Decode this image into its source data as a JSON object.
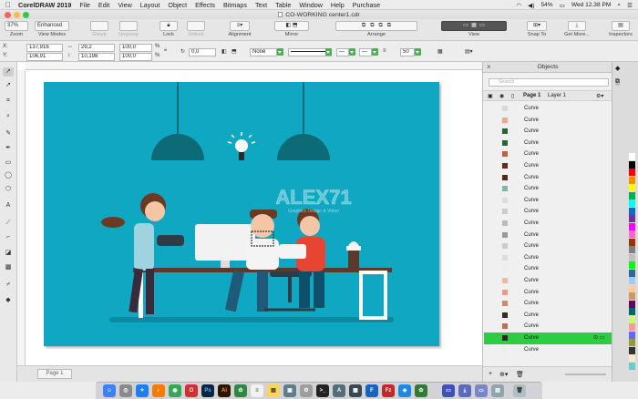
{
  "menubar": {
    "app_name": "CorelDRAW 2019",
    "items": [
      "File",
      "Edit",
      "View",
      "Layout",
      "Object",
      "Effects",
      "Bitmaps",
      "Text",
      "Table",
      "Window",
      "Help",
      "Purchase"
    ],
    "battery": "54%",
    "clock": "Wed 12.38 PM"
  },
  "window": {
    "title": "CO-WORKING center1.cdr"
  },
  "toolbar": {
    "zoom_value": "37%",
    "zoom_label": "Zoom",
    "view_mode_value": "Enhanced",
    "view_mode_label": "View Modes",
    "group_label": "Group",
    "ungroup_label": "Ungroup",
    "lock_label": "Lock",
    "unlock_label": "Unlock",
    "alignment_label": "Alignment",
    "mirror_label": "Mirror",
    "arrange_label": "Arrange",
    "view_label": "View",
    "snap_label": "Snap To",
    "getmore_label": "Get More...",
    "inspectors_label": "Inspectors"
  },
  "propbar": {
    "x": "137,916",
    "y": "106,91",
    "w": "29,2",
    "h": "10,198",
    "sx": "100,0",
    "sy": "100,0",
    "pct": "%",
    "angle": "0,0",
    "fill": "None",
    "outline_width": "50"
  },
  "canvas": {
    "watermark": "ALEX71",
    "watermark_sub": "Graphics Design & Video"
  },
  "pagebar": {
    "tab": "Page 1"
  },
  "objects": {
    "title": "Objects",
    "search_placeholder": "Search",
    "page": "Page 1",
    "layer": "Layer 1",
    "rows": [
      {
        "name": "Curve",
        "swatch": "#d9d9d9"
      },
      {
        "name": "Curve",
        "swatch": "#f0a58a"
      },
      {
        "name": "Curve",
        "swatch": "#1f6b2e"
      },
      {
        "name": "Curve",
        "swatch": "#1f6b2e"
      },
      {
        "name": "Curve",
        "swatch": "#c06040"
      },
      {
        "name": "Curve",
        "swatch": "#6a2c1a"
      },
      {
        "name": "Curve",
        "swatch": "#5a2818"
      },
      {
        "name": "Curve",
        "swatch": "#7fb8a8"
      },
      {
        "name": "Curve",
        "swatch": "#dddddd"
      },
      {
        "name": "Curve",
        "swatch": "#cccccc"
      },
      {
        "name": "Curve",
        "swatch": "#bbbbbb"
      },
      {
        "name": "Curve",
        "swatch": "#999999"
      },
      {
        "name": "Curve",
        "swatch": "#cccccc"
      },
      {
        "name": "Curve",
        "swatch": "#dddddd"
      },
      {
        "name": "Curve",
        "swatch": "#eeeeee"
      },
      {
        "name": "Curve",
        "swatch": "#f3b89c"
      },
      {
        "name": "Curve",
        "swatch": "#e8a080"
      },
      {
        "name": "Curve",
        "swatch": "#d08a6a"
      },
      {
        "name": "Curve",
        "swatch": "#3a2a20"
      },
      {
        "name": "Curve",
        "swatch": "#c07050"
      },
      {
        "name": "Curve",
        "swatch": "#2a2a2a"
      },
      {
        "name": "Curve",
        "swatch": "#eeeeee"
      }
    ],
    "selected_index": 20
  },
  "colors": {
    "artboard": "#0fa7c2",
    "selection": "#2ecc40",
    "lamp": "#0d6b78"
  },
  "palette": [
    "#ffffff",
    "#000000",
    "#ff0000",
    "#ff8c00",
    "#ffff00",
    "#00b050",
    "#00ffff",
    "#0070c0",
    "#7030a0",
    "#ff00ff",
    "#ff66cc",
    "#993300",
    "#808080",
    "#c0c0c0",
    "#00ff00",
    "#336699",
    "#99ccff",
    "#ffcc99",
    "#cc9966",
    "#660066",
    "#006666",
    "#ccff66",
    "#ff9999",
    "#6666ff",
    "#999933",
    "#333333",
    "#ffe6cc",
    "#66cccc"
  ]
}
